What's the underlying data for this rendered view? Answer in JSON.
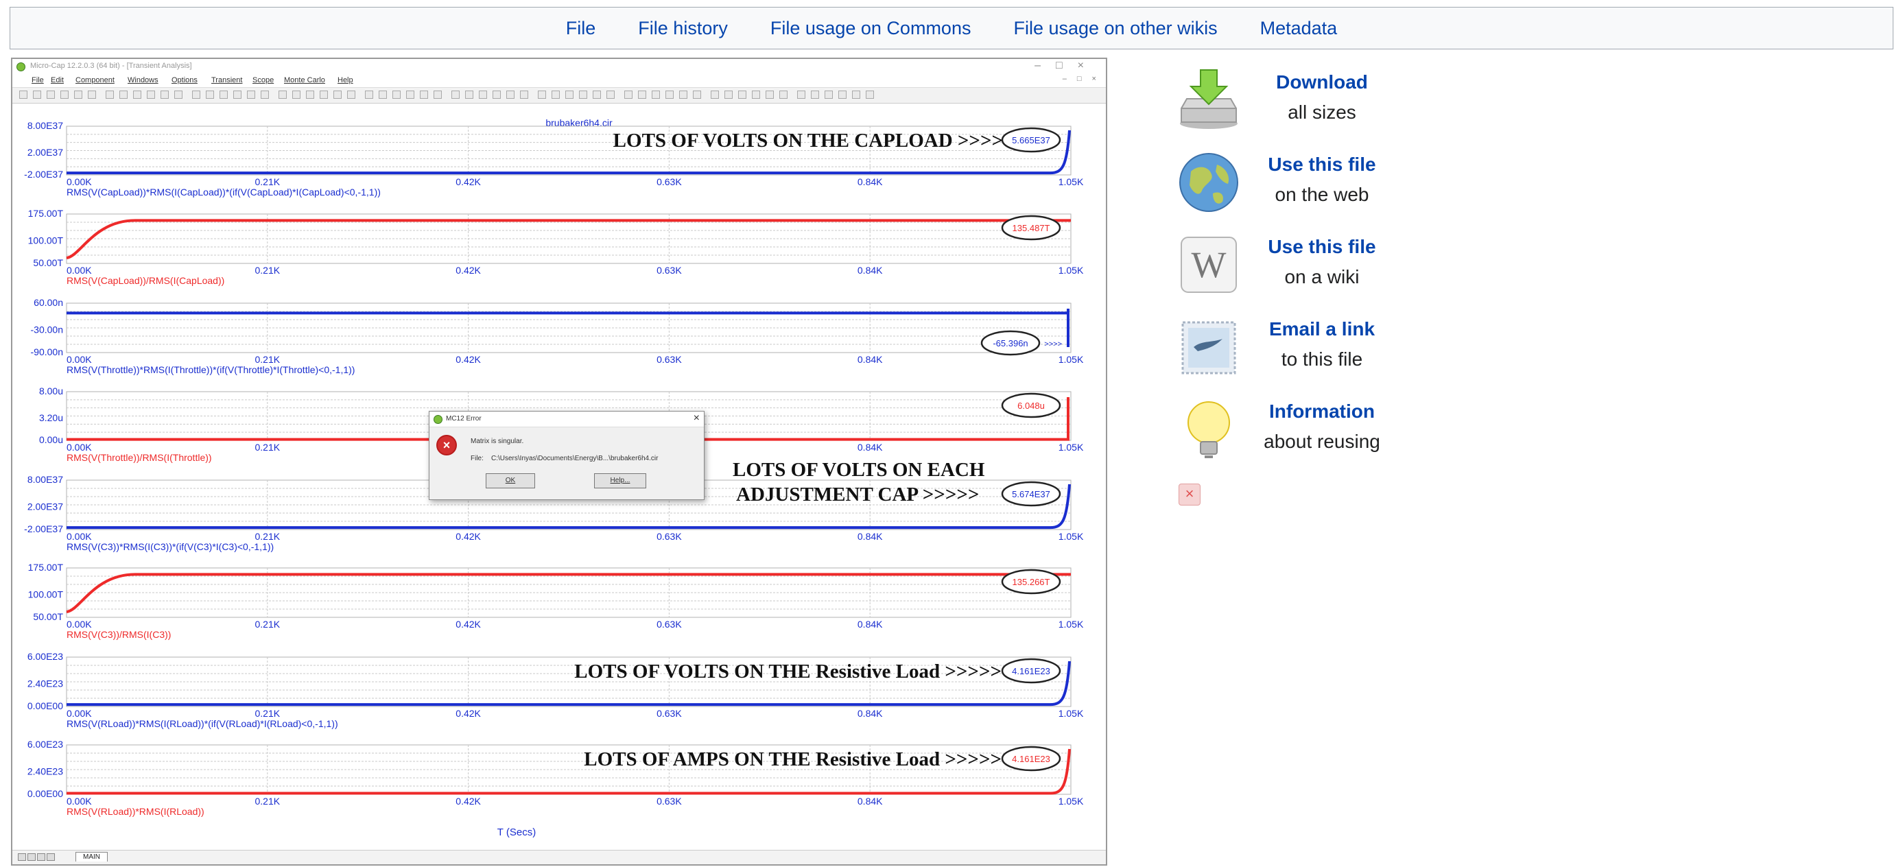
{
  "nav": {
    "file": "File",
    "file_history": "File history",
    "file_usage_commons": "File usage on Commons",
    "file_usage_other": "File usage on other wikis",
    "metadata": "Metadata"
  },
  "app": {
    "title": "Micro-Cap 12.2.0.3 (64 bit) - [Transient Analysis]",
    "menu": [
      "File",
      "Edit",
      "Component",
      "Windows",
      "Options",
      "Transient",
      "Scope",
      "Monte Carlo",
      "Help"
    ],
    "circuit_name": "brubaker6h4.cir",
    "x_axis_title": "T (Secs)",
    "x_ticks": [
      "0.00K",
      "0.21K",
      "0.42K",
      "0.63K",
      "0.84K",
      "1.05K"
    ],
    "tab_label": "MAIN"
  },
  "colors": {
    "blue_trace": "#1a2ecf",
    "red_trace": "#ee2a2a",
    "link": "#0645ad"
  },
  "chart_data": [
    {
      "type": "line",
      "series_color": "blue",
      "ylabels": [
        "8.00E37",
        "2.00E37",
        "-2.00E37"
      ],
      "ylim": [
        -2e+37,
        8e+37
      ],
      "expression": "RMS(V(CapLoad))*RMS(I(CapLoad))*(if(V(CapLoad)*I(CapLoad)<0,-1,1))",
      "marker": "5.665E37",
      "annotation": [
        "LOTS OF VOLTS ON THE CAPLOAD >>>>"
      ]
    },
    {
      "type": "line",
      "series_color": "red",
      "ylabels": [
        "175.00T",
        "100.00T",
        "50.00T"
      ],
      "ylim": [
        50000000000000.0,
        175000000000000.0
      ],
      "expression": "RMS(V(CapLoad))/RMS(I(CapLoad))",
      "marker": "135.487T",
      "annotation": []
    },
    {
      "type": "line",
      "series_color": "blue",
      "ylabels": [
        "60.00n",
        "-30.00n",
        "-90.00n"
      ],
      "ylim": [
        -9e-08,
        6e-08
      ],
      "expression": "RMS(V(Throttle))*RMS(I(Throttle))*(if(V(Throttle)*I(Throttle)<0,-1,1))",
      "marker": "-65.396n",
      "annotation": [
        ">>>>"
      ]
    },
    {
      "type": "line",
      "series_color": "red",
      "ylabels": [
        "8.00u",
        "3.20u",
        "0.00u"
      ],
      "ylim": [
        0,
        8e-06
      ],
      "expression": "RMS(V(Throttle))/RMS(I(Throttle))",
      "marker": "6.048u",
      "annotation": []
    },
    {
      "type": "line",
      "series_color": "blue",
      "ylabels": [
        "8.00E37",
        "2.00E37",
        "-2.00E37"
      ],
      "ylim": [
        -2e+37,
        8e+37
      ],
      "expression": "RMS(V(C3))*RMS(I(C3))*(if(V(C3)*I(C3)<0,-1,1))",
      "marker": "5.674E37",
      "annotation": [
        "LOTS OF VOLTS ON EACH",
        "ADJUSTMENT CAP >>>>>"
      ]
    },
    {
      "type": "line",
      "series_color": "red",
      "ylabels": [
        "175.00T",
        "100.00T",
        "50.00T"
      ],
      "ylim": [
        50000000000000.0,
        175000000000000.0
      ],
      "expression": "RMS(V(C3))/RMS(I(C3))",
      "marker": "135.266T",
      "annotation": []
    },
    {
      "type": "line",
      "series_color": "blue",
      "ylabels": [
        "6.00E23",
        "2.40E23",
        "0.00E00"
      ],
      "ylim": [
        0,
        6e+23
      ],
      "expression": "RMS(V(RLoad))*RMS(I(RLoad))*(if(V(RLoad)*I(RLoad)<0,-1,1))",
      "marker": "4.161E23",
      "annotation": [
        "LOTS OF VOLTS ON THE  Resistive Load  >>>>>"
      ]
    },
    {
      "type": "line",
      "series_color": "red",
      "ylabels": [
        "6.00E23",
        "2.40E23",
        "0.00E00"
      ],
      "ylim": [
        0,
        6e+23
      ],
      "expression": "RMS(V(RLoad))*RMS(I(RLoad))",
      "marker": "4.161E23",
      "annotation": [
        "LOTS OF  AMPS  ON THE  Resistive Load  >>>>>"
      ]
    }
  ],
  "dialog": {
    "title": "MC12 Error",
    "message": "Matrix is singular.",
    "file_label": "File:",
    "file_path": "C:\\Users\\Inyas\\Documents\\Energy\\B...\\brubaker6h4.cir",
    "ok": "OK",
    "help": "Help..."
  },
  "actions": [
    {
      "link": "Download",
      "sub": "all sizes",
      "icon": "download-icon"
    },
    {
      "link": "Use this file",
      "sub": "on the web",
      "icon": "globe-icon"
    },
    {
      "link": "Use this file",
      "sub": "on a wiki",
      "icon": "wiki-icon"
    },
    {
      "link": "Email a link",
      "sub": "to this file",
      "icon": "email-icon"
    },
    {
      "link": "Information",
      "sub": "about reusing",
      "icon": "lightbulb-icon"
    }
  ]
}
